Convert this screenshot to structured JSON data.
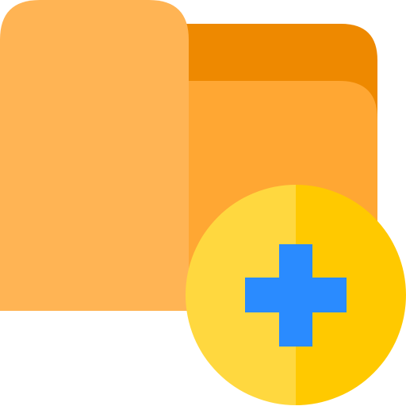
{
  "icon": {
    "name": "add-folder-icon",
    "colors": {
      "folder_back": "#EE8900",
      "folder_front": "#FFA733",
      "folder_tab": "#FFB454",
      "badge_left": "#FFD83F",
      "badge_right": "#FFC900",
      "plus": "#2A8BFF"
    }
  }
}
